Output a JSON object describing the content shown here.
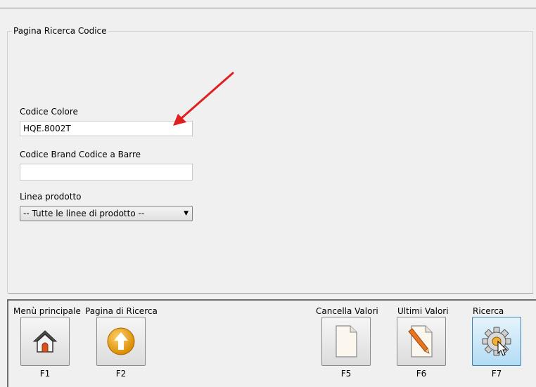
{
  "group": {
    "title": "Pagina Ricerca Codice"
  },
  "fields": {
    "codice_colore": {
      "label": "Codice Colore",
      "value": "HQE.8002T"
    },
    "codice_brand": {
      "label": "Codice Brand Codice a Barre",
      "value": ""
    },
    "linea_prodotto": {
      "label": "Linea prodotto",
      "selected": "-- Tutte le linee di prodotto --"
    }
  },
  "toolbar": {
    "buttons": [
      {
        "label": "Menù principale",
        "key": "F1",
        "icon": "home-icon"
      },
      {
        "label": "Pagina di Ricerca",
        "key": "F2",
        "icon": "up-arrow-icon"
      },
      {
        "label": "Cancella Valori",
        "key": "F5",
        "icon": "blank-document-icon"
      },
      {
        "label": "Ultimi Valori",
        "key": "F6",
        "icon": "edit-document-icon"
      },
      {
        "label": "Ricerca",
        "key": "F7",
        "icon": "gear-icon"
      }
    ]
  },
  "colors": {
    "annotation_arrow": "#e02020",
    "active_button": "#b4dcf5"
  }
}
